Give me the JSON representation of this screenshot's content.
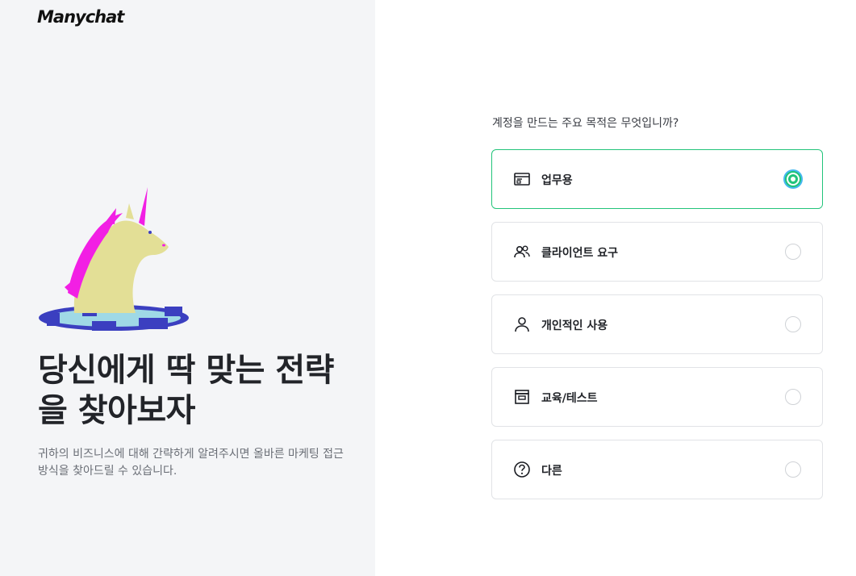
{
  "brand": {
    "logo_text": "Manychat"
  },
  "hero": {
    "headline": "당신에게 딱 맞는 전략을 찾아보자",
    "subtext": "귀하의 비즈니스에 대해 간략하게 알려주시면 올바른 마케팅 접근 방식을 찾아드릴 수 있습니다.",
    "illustration": "unicorn-in-hole"
  },
  "form": {
    "question": "계정을 만드는 주요 목적은 무엇입니까?",
    "options": [
      {
        "label": "업무용",
        "icon": "browser-window-icon",
        "selected": true
      },
      {
        "label": "클라이언트 요구",
        "icon": "users-icon",
        "selected": false
      },
      {
        "label": "개인적인 사용",
        "icon": "user-icon",
        "selected": false
      },
      {
        "label": "교육/테스트",
        "icon": "archive-box-icon",
        "selected": false
      },
      {
        "label": "다른",
        "icon": "question-circle-icon",
        "selected": false
      }
    ]
  },
  "colors": {
    "accent_green": "#20c47a",
    "focus_ring": "#46b8f0",
    "left_bg": "#f4f5f7",
    "unicorn_body": "#e3df96",
    "unicorn_mane": "#f21fe4",
    "hole_blue": "#3b3fc0",
    "hole_light": "#9fd9e6"
  }
}
